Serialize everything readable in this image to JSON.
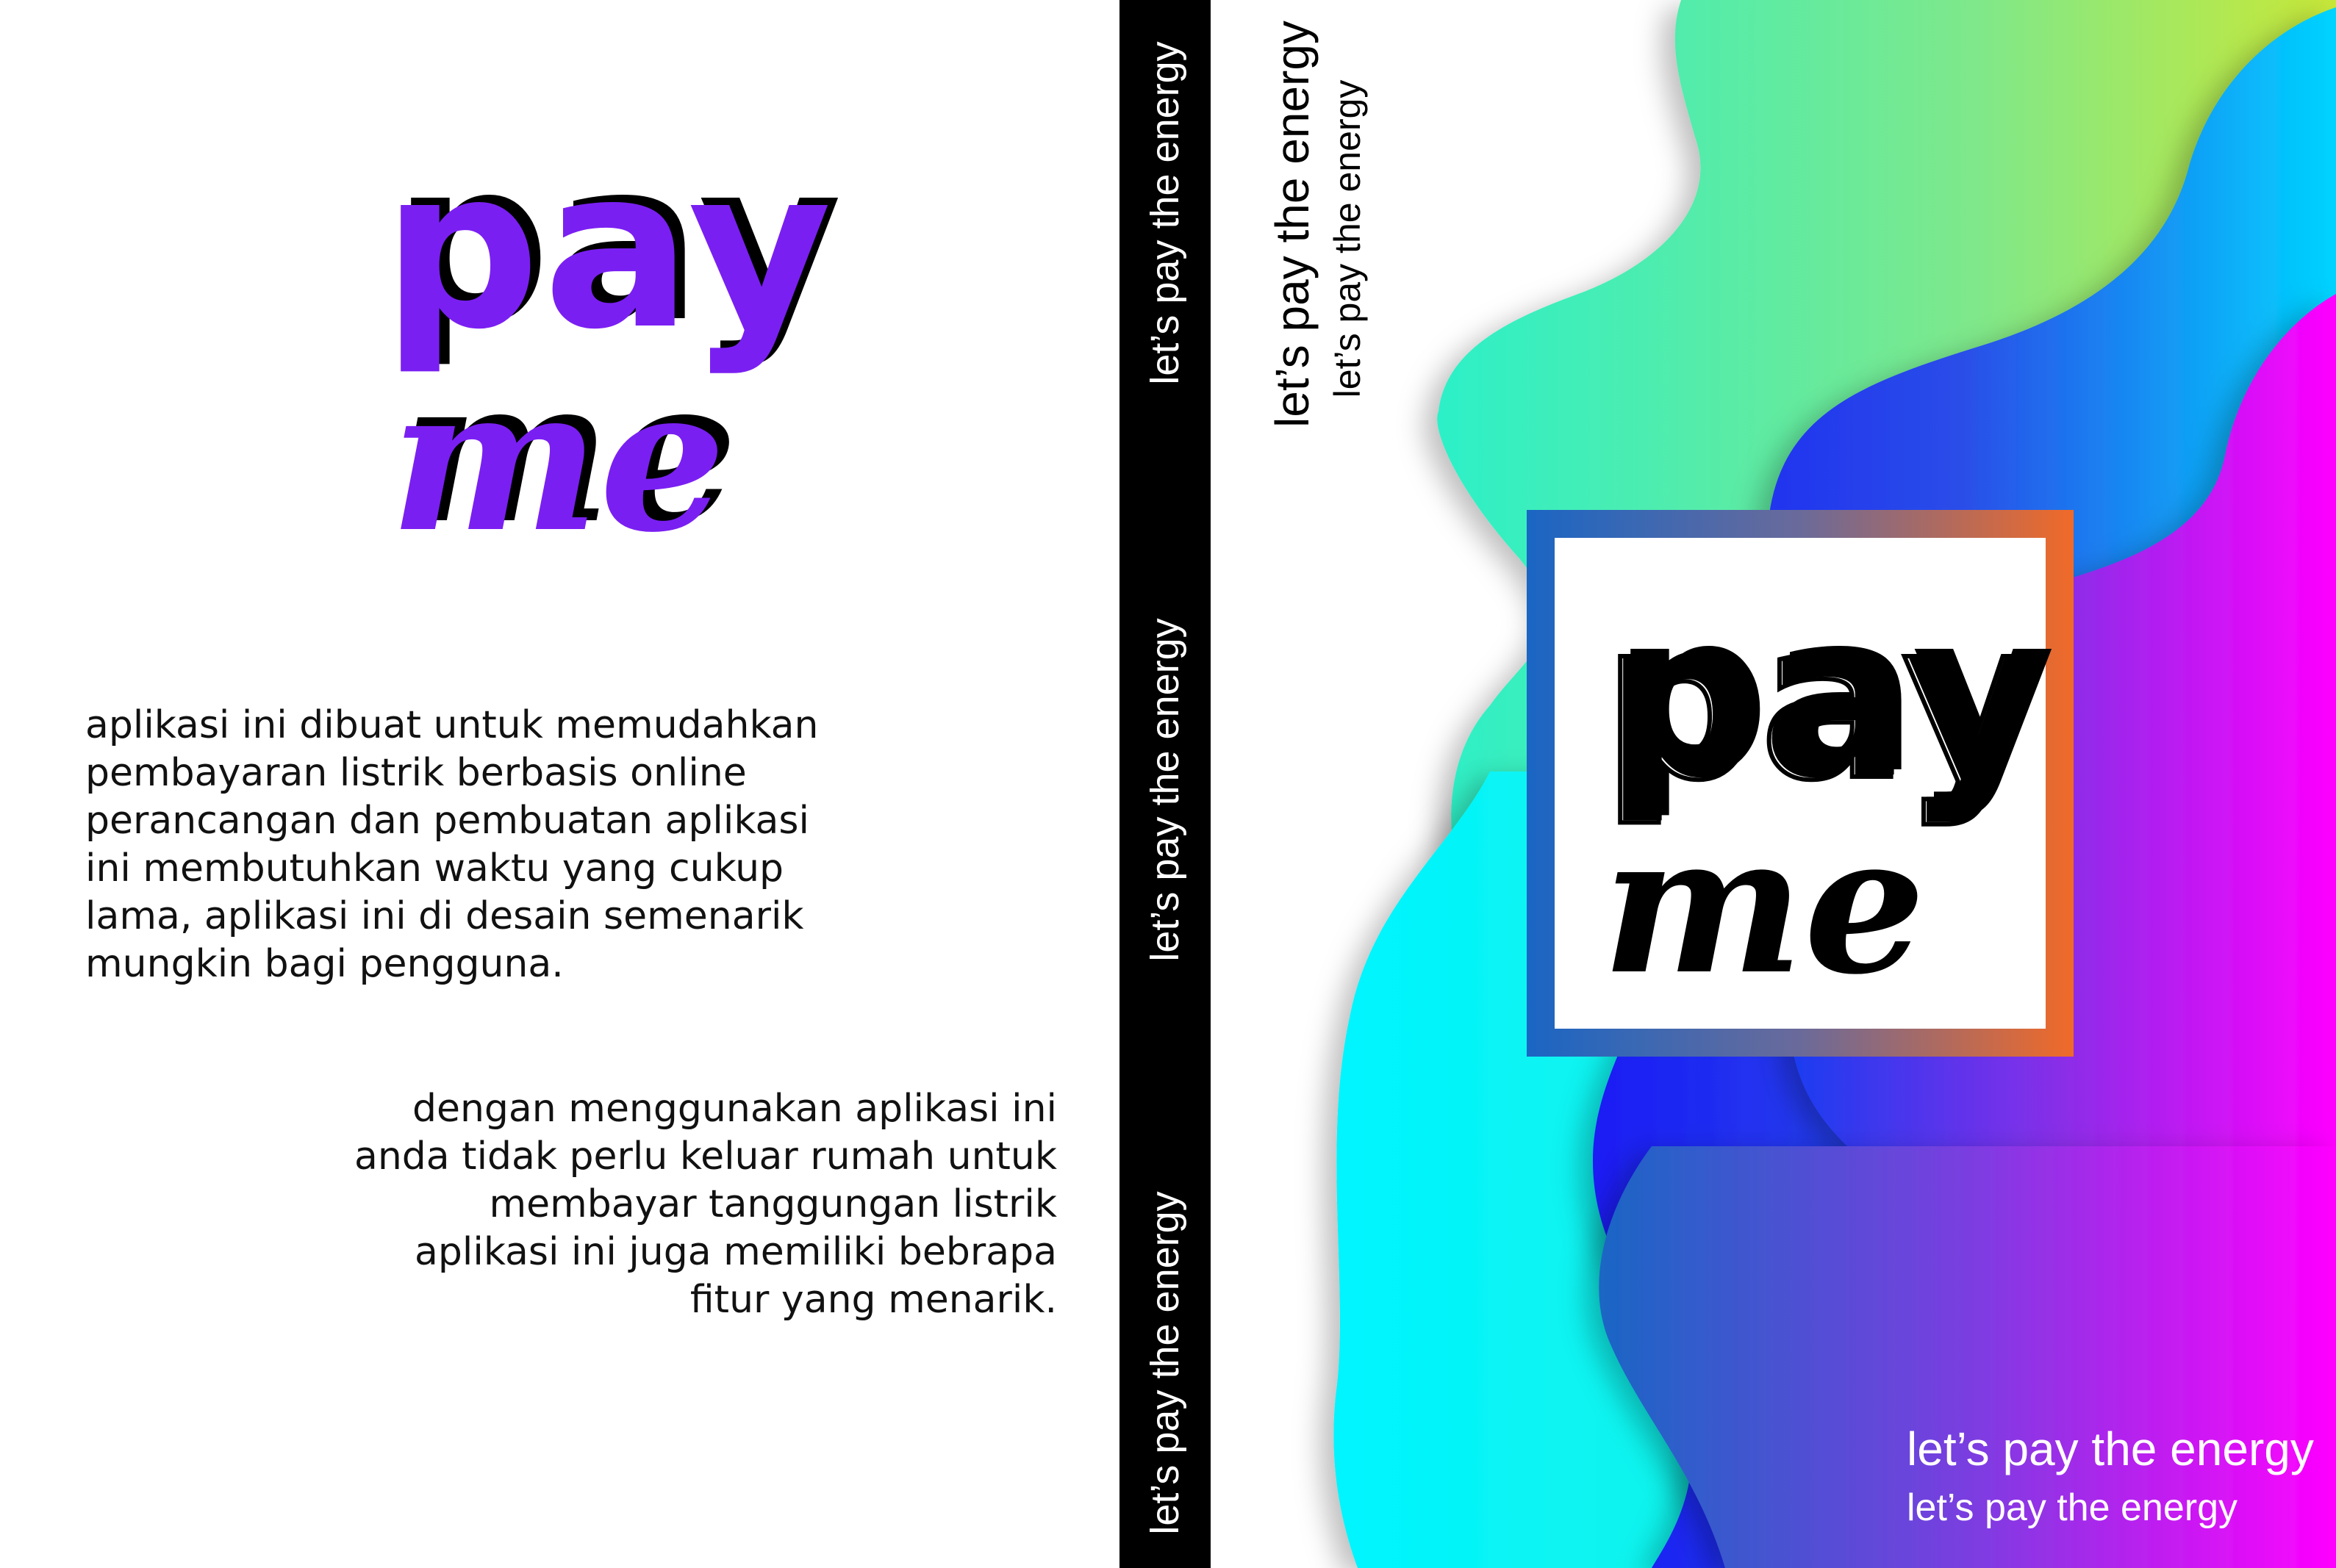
{
  "back_cover": {
    "logo": {
      "word1": "pay",
      "word2": "me",
      "color": "#7a1ff2",
      "shadow_color": "#000000"
    },
    "paragraph1": [
      "aplikasi ini dibuat untuk memudahkan",
      "pembayaran listrik berbasis online",
      "perancangan dan pembuatan aplikasi",
      "ini membutuhkan waktu yang cukup",
      "lama, aplikasi ini di desain semenarik",
      "mungkin bagi pengguna."
    ],
    "paragraph2": [
      "dengan menggunakan aplikasi ini",
      "anda tidak perlu keluar rumah untuk",
      "membayar tanggungan listrik",
      "aplikasi ini juga memiliki bebrapa",
      "fitur yang menarik."
    ]
  },
  "spine": {
    "taglines": [
      "let’s pay the energy",
      "let’s pay the energy",
      "let’s pay the energy"
    ],
    "background": "#000000"
  },
  "front_cover": {
    "vertical_tagline_large": "let’s pay the energy",
    "vertical_tagline_small": "let’s pay the energy",
    "logo": {
      "word1": "pay",
      "word2": "me",
      "color": "#000000"
    },
    "box_gradient": [
      "#1a66c4",
      "#f06a28"
    ],
    "bottom_tagline_large": "let’s pay the energy",
    "bottom_tagline_small": "let’s pay the energy",
    "wave_colors": [
      "#00f5ff",
      "#2cf0c8",
      "#a8e850",
      "#1a1cf5",
      "#ff00ff"
    ]
  }
}
